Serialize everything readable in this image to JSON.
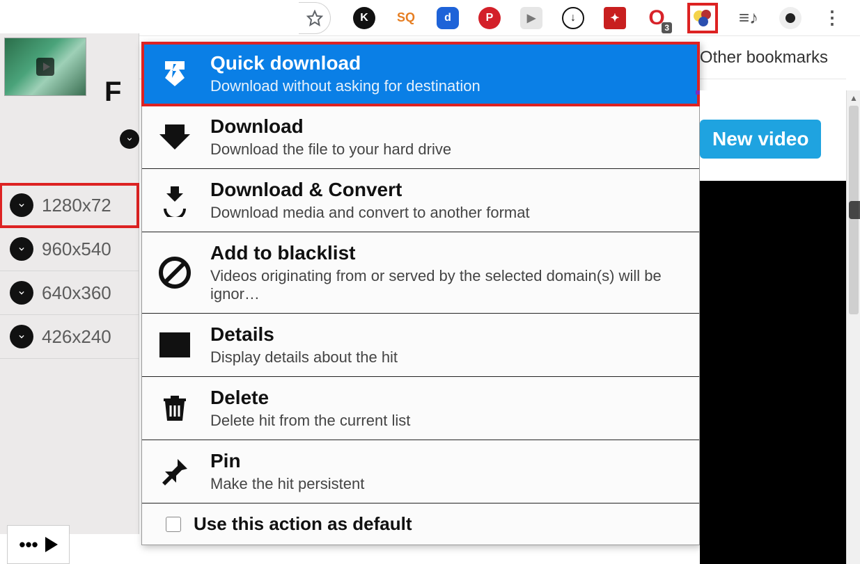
{
  "toolbar": {
    "star": "star",
    "extensions": [
      {
        "name": "k-ext",
        "letter": "K",
        "bg": "#111"
      },
      {
        "name": "sq-ext",
        "letter": "SQ",
        "bg": "#e67e22"
      },
      {
        "name": "d-ext",
        "letter": "d",
        "bg": "#1e63d8"
      },
      {
        "name": "pinterest-ext",
        "letter": "P",
        "bg": "#d32029"
      },
      {
        "name": "video-ext",
        "letter": "▶",
        "bg": "#8a8a8a"
      },
      {
        "name": "down-ext",
        "letter": "↓",
        "bg": "#111"
      },
      {
        "name": "magic-ext",
        "letter": "✦",
        "bg": "#c81f1f"
      },
      {
        "name": "opera-ext",
        "letter": "O",
        "bg": "#d8232a",
        "badge": "3"
      },
      {
        "name": "balls-ext",
        "letter": "",
        "bg": "transparent",
        "highlight": true
      }
    ],
    "music_icon": "music",
    "avatar": "user"
  },
  "bookmarks": {
    "other": "Other bookmarks"
  },
  "left_panel": {
    "title_letter": "F",
    "resolutions": [
      {
        "label": "1280x72",
        "highlight": true
      },
      {
        "label": "960x540"
      },
      {
        "label": "640x360"
      },
      {
        "label": "426x240"
      }
    ]
  },
  "context_menu": [
    {
      "key": "quick-download",
      "title": "Quick download",
      "desc": "Download without asking for destination",
      "active": true,
      "highlight": true
    },
    {
      "key": "download",
      "title": "Download",
      "desc": "Download the file to your hard drive"
    },
    {
      "key": "download-convert",
      "title": "Download & Convert",
      "desc": "Download media and convert to another format"
    },
    {
      "key": "blacklist",
      "title": "Add to blacklist",
      "desc": "Videos originating from or served by the selected domain(s) will be ignor…"
    },
    {
      "key": "details",
      "title": "Details",
      "desc": "Display details about the hit"
    },
    {
      "key": "delete",
      "title": "Delete",
      "desc": "Delete hit from the current list"
    },
    {
      "key": "pin",
      "title": "Pin",
      "desc": "Make the hit persistent"
    },
    {
      "key": "default",
      "title": "Use this action as default",
      "checkbox": true
    }
  ],
  "right": {
    "new_video": "New video"
  }
}
